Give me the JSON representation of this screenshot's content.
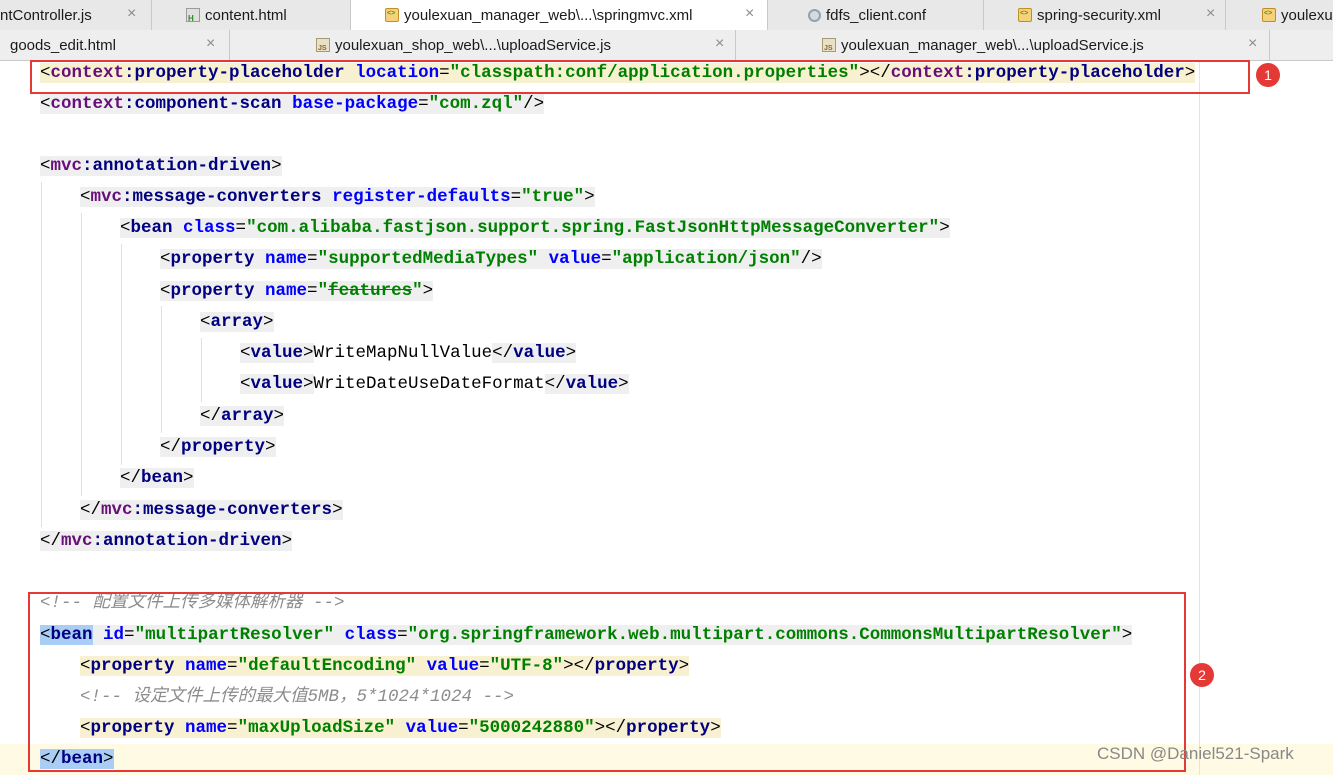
{
  "tabs_row1": [
    {
      "label": "ntController.js",
      "icon": "none",
      "active": false
    },
    {
      "label": "content.html",
      "icon": "html-file-icon",
      "active": false
    },
    {
      "label": "youlexuan_manager_web\\...\\springmvc.xml",
      "icon": "xml-file-icon",
      "active": true
    },
    {
      "label": "fdfs_client.conf",
      "icon": "config-file-icon",
      "active": false
    },
    {
      "label": "spring-security.xml",
      "icon": "xml-file-icon",
      "active": false
    },
    {
      "label": "youlexu",
      "icon": "xml-file-icon",
      "active": false
    }
  ],
  "tabs_row2": [
    {
      "label": "goods_edit.html",
      "icon": "none",
      "active": false
    },
    {
      "label": "youlexuan_shop_web\\...\\uploadService.js",
      "icon": "js-file-icon",
      "active": false
    },
    {
      "label": "youlexuan_manager_web\\...\\uploadService.js",
      "icon": "js-file-icon",
      "active": false
    }
  ],
  "close_glyph": "×",
  "code": {
    "l1": {
      "p1": "<",
      "ns": "context",
      "tag": ":property-placeholder",
      "attr1": " location",
      "eq1": "=",
      "val1": "\"classpath:conf/application.properties\"",
      "p2": "></",
      "ns2": "context",
      "tag2": ":property-placeholder",
      "p3": ">"
    },
    "l2": {
      "p1": "<",
      "ns": "context",
      "tag": ":component-scan",
      "attr1": " base-package",
      "eq1": "=",
      "val1": "\"com.zql\"",
      "p2": "/>"
    },
    "l4": {
      "p1": "<",
      "ns": "mvc",
      "tag": ":annotation-driven",
      "p2": ">"
    },
    "l5": {
      "p1": "<",
      "ns": "mvc",
      "tag": ":message-converters",
      "attr1": " register-defaults",
      "eq1": "=",
      "val1": "\"true\"",
      "p2": ">"
    },
    "l6": {
      "p1": "<",
      "tag": "bean",
      "attr1": " class",
      "eq1": "=",
      "val1": "\"com.alibaba.fastjson.support.spring.FastJsonHttpMessageConverter\"",
      "p2": ">"
    },
    "l7": {
      "p1": "<",
      "tag": "property",
      "attr1": " name",
      "eq1": "=",
      "val1": "\"supportedMediaTypes\"",
      "attr2": " value",
      "eq2": "=",
      "val2": "\"application/json\"",
      "p2": "/>"
    },
    "l8": {
      "p1": "<",
      "tag": "property",
      "attr1": " name",
      "eq1": "=",
      "q1": "\"",
      "val1": "features",
      "q2": "\"",
      "p2": ">"
    },
    "l9": {
      "p1": "<",
      "tag": "array",
      "p2": ">"
    },
    "l10": {
      "p1": "<",
      "tag": "value",
      "p2": ">",
      "text": "WriteMapNullValue",
      "p3": "</",
      "tag2": "value",
      "p4": ">"
    },
    "l11": {
      "p1": "<",
      "tag": "value",
      "p2": ">",
      "text": "WriteDateUseDateFormat",
      "p3": "</",
      "tag2": "value",
      "p4": ">"
    },
    "l12": {
      "p1": "</",
      "tag": "array",
      "p2": ">"
    },
    "l13": {
      "p1": "</",
      "tag": "property",
      "p2": ">"
    },
    "l14": {
      "p1": "</",
      "tag": "bean",
      "p2": ">"
    },
    "l15": {
      "p1": "</",
      "ns": "mvc",
      "tag": ":message-converters",
      "p2": ">"
    },
    "l16": {
      "p1": "</",
      "ns": "mvc",
      "tag": ":annotation-driven",
      "p2": ">"
    },
    "l18": {
      "comment": "<!-- 配置文件上传多媒体解析器 -->"
    },
    "l19": {
      "p1": "<",
      "tag": "bean",
      "attr1": " id",
      "eq1": "=",
      "val1": "\"multipartResolver\"",
      "attr2": " class",
      "eq2": "=",
      "val2": "\"org.springframework.web.multipart.commons.CommonsMultipartResolver\"",
      "p2": ">"
    },
    "l20": {
      "p1": "<",
      "tag": "property",
      "attr1": " name",
      "eq1": "=",
      "val1": "\"defaultEncoding\"",
      "attr2": " value",
      "eq2": "=",
      "val2": "\"UTF-8\"",
      "p2": "></",
      "tag2": "property",
      "p3": ">"
    },
    "l21": {
      "comment": "<!-- 设定文件上传的最大值5MB，5*1024*1024 -->"
    },
    "l22": {
      "p1": "<",
      "tag": "property",
      "attr1": " name",
      "eq1": "=",
      "val1": "\"maxUploadSize\"",
      "attr2": " value",
      "eq2": "=",
      "val2": "\"5000242880\"",
      "p2": "></",
      "tag2": "property",
      "p3": ">"
    },
    "l23": {
      "p1": "</",
      "tag": "bean",
      "p2": ">"
    }
  },
  "annotations": {
    "badge1": "1",
    "badge2": "2",
    "color": "#e53935"
  },
  "watermark": "CSDN @Daniel521-Spark"
}
